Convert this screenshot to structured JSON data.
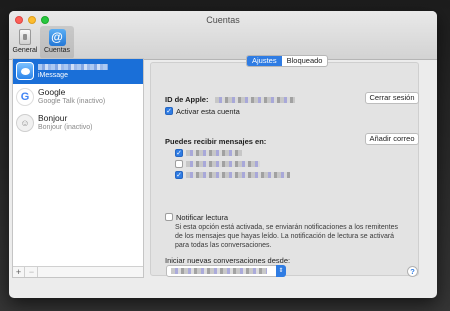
{
  "window": {
    "title": "Cuentas"
  },
  "toolbar": {
    "general_label": "General",
    "accounts_label": "Cuentas",
    "accounts_icon_glyph": "@"
  },
  "sidebar": {
    "accounts": [
      {
        "name": "",
        "service": "iMessage",
        "icon": "imessage-icon",
        "selected": true
      },
      {
        "name": "Google",
        "service": "Google Talk (inactivo)",
        "icon": "google-icon",
        "selected": false
      },
      {
        "name": "Bonjour",
        "service": "Bonjour (inactivo)",
        "icon": "bonjour-icon",
        "selected": false
      }
    ],
    "add_label": "+",
    "remove_label": "−"
  },
  "tabs": {
    "ajustes": "Ajustes",
    "bloqueado": "Bloqueado",
    "active": "Ajustes"
  },
  "settings": {
    "apple_id_label": "ID de Apple:",
    "sign_out_button": "Cerrar sesión",
    "activate_label": "Activar esta cuenta",
    "activate_checked": true,
    "receive_label": "Puedes recibir mensajes en:",
    "add_email_button": "Añadir correo",
    "addresses_checked": [
      true,
      false,
      true
    ],
    "read_receipt_label": "Notificar lectura",
    "read_receipt_checked": false,
    "read_receipt_desc": "Si esta opción está activada, se enviarán notificaciones a los remitentes de los mensajes que hayas leído. La notificación de lectura se activará para todas las conversaciones.",
    "start_from_label": "Iniciar nuevas conversaciones desde:",
    "help_glyph": "?"
  },
  "colors": {
    "accent": "#2f7ce3",
    "selection": "#1a6fd8"
  }
}
